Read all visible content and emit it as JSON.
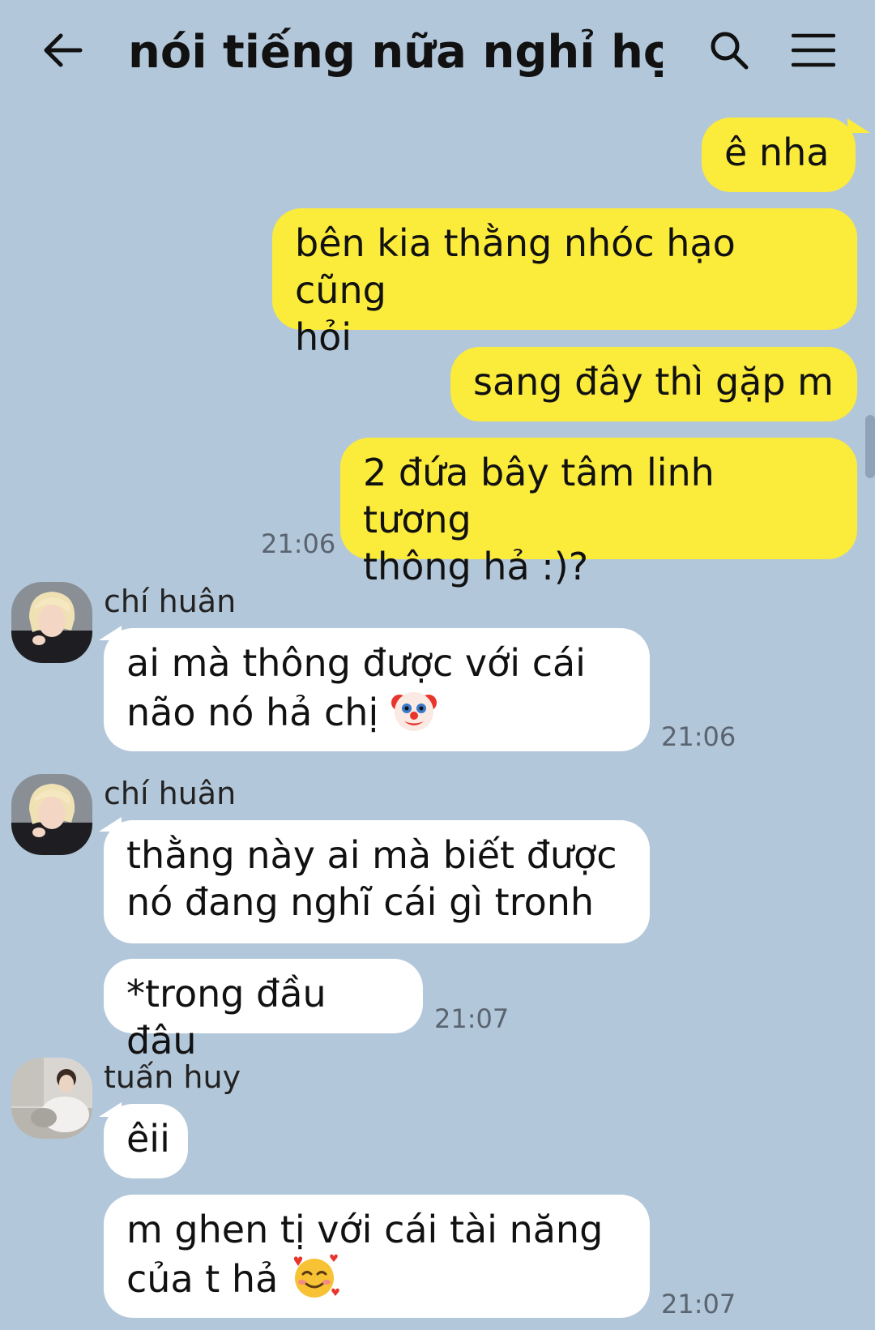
{
  "header": {
    "title": "nói tiếng nữa nghỉ học...",
    "back_icon": "arrow-left-icon",
    "search_icon": "search-icon",
    "menu_icon": "hamburger-menu-icon"
  },
  "outgoing": [
    {
      "lines": [
        "ê nha"
      ]
    },
    {
      "lines": [
        "bên kia thằng nhóc hạo cũng",
        "hỏi"
      ]
    },
    {
      "lines": [
        "sang đây thì gặp m"
      ]
    },
    {
      "lines": [
        "2 đứa bây tâm linh tương",
        "thông hả :)?"
      ],
      "time": "21:06"
    }
  ],
  "incoming": [
    {
      "sender": "chí huân",
      "lines": [
        "ai mà thông được với cái",
        "não nó hả chị"
      ],
      "emoji": "clown-face-emoji",
      "time": "21:06"
    },
    {
      "sender": "chí huân",
      "lines": [
        "thằng này ai mà biết được",
        "nó đang nghĩ cái gì tronh"
      ]
    },
    {
      "lines": [
        "*trong đầu đâu"
      ],
      "time": "21:07"
    },
    {
      "sender": "tuấn huy",
      "lines": [
        "êii"
      ]
    },
    {
      "lines": [
        "m ghen tị với cái tài năng",
        "của t hả"
      ],
      "emoji": "smiling-face-with-hearts-emoji",
      "time": "21:07"
    }
  ]
}
